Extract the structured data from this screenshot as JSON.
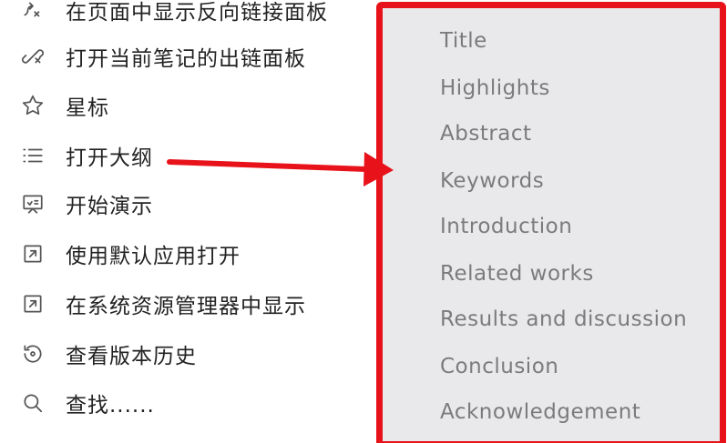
{
  "menu": {
    "items": [
      {
        "label": "在页面中显示反向链接面板",
        "icon": "backlink-icon"
      },
      {
        "label": "打开当前笔记的出链面板",
        "icon": "outlink-icon"
      },
      {
        "label": "星标",
        "icon": "star-icon"
      },
      {
        "label": "打开大纲",
        "icon": "outline-list-icon"
      },
      {
        "label": "开始演示",
        "icon": "presentation-icon"
      },
      {
        "label": "使用默认应用打开",
        "icon": "open-external-icon"
      },
      {
        "label": "在系统资源管理器中显示",
        "icon": "reveal-in-explorer-icon"
      },
      {
        "label": "查看版本历史",
        "icon": "history-icon"
      },
      {
        "label": "查找......",
        "icon": "search-icon"
      }
    ]
  },
  "outline": {
    "items": [
      "Title",
      "Highlights",
      "Abstract",
      "Keywords",
      "Introduction",
      "Related works",
      "Results and discussion",
      "Conclusion",
      "Acknowledgement"
    ]
  },
  "colors": {
    "highlight_border": "#e8121a",
    "arrow": "#e8121a",
    "panel_bg": "#e9e9ec",
    "outline_text": "#7b7b7d",
    "menu_text": "#222222"
  }
}
